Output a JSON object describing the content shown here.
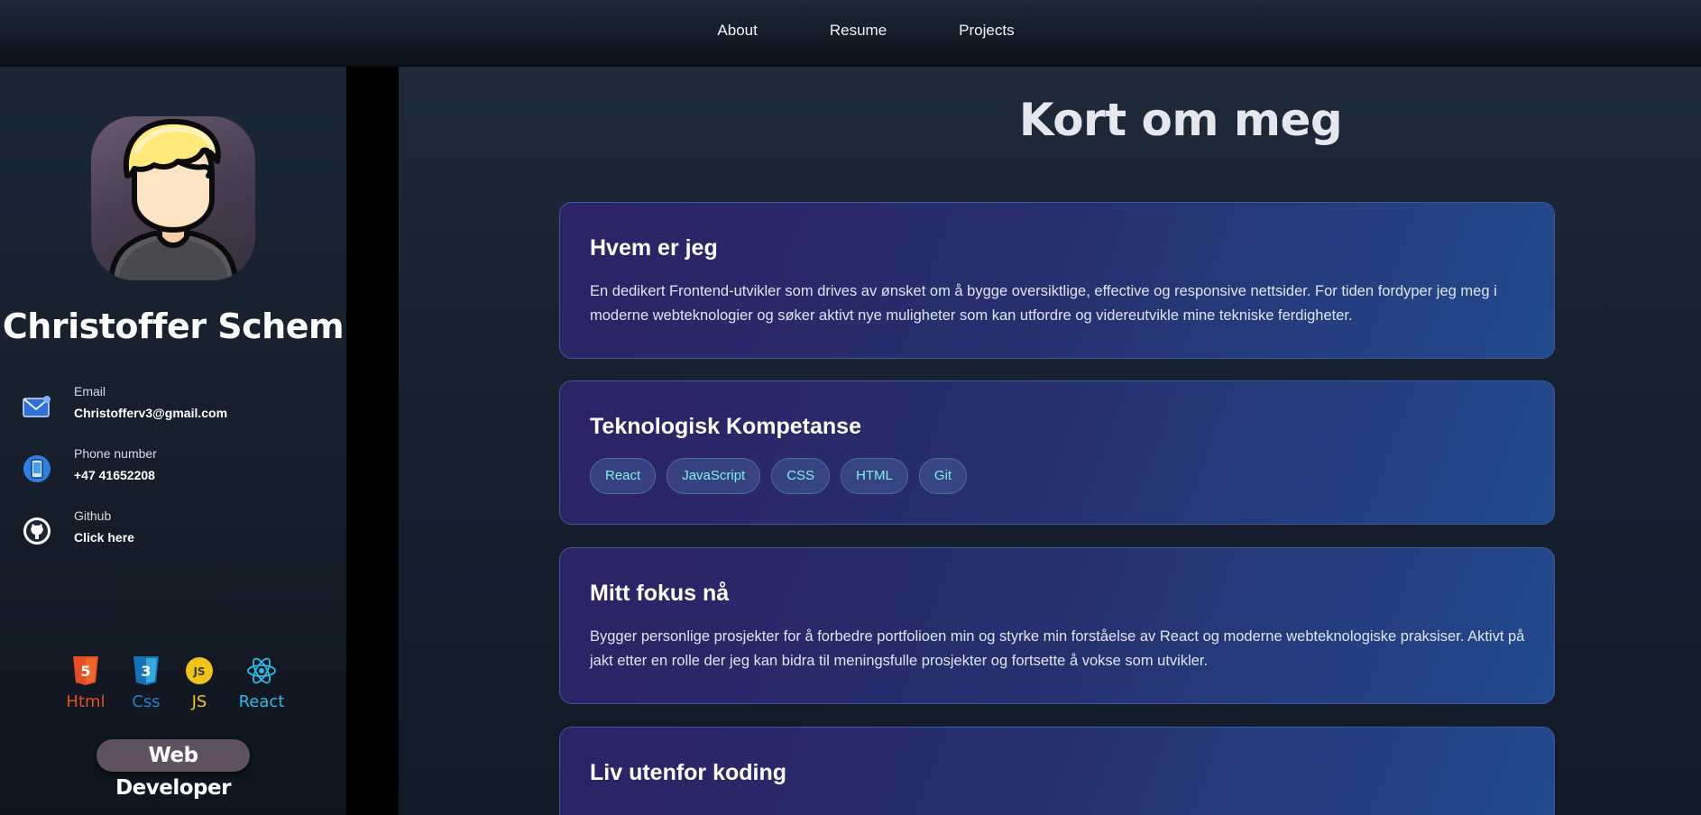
{
  "nav": {
    "items": [
      "About",
      "Resume",
      "Projects"
    ]
  },
  "profile": {
    "name": "Christoffer Schem",
    "contacts": [
      {
        "label": "Email",
        "value": "Christofferv3@gmail.com",
        "icon": "mail-icon"
      },
      {
        "label": "Phone number",
        "value": "+47 41652208",
        "icon": "phone-icon"
      },
      {
        "label": "Github",
        "value": "Click here",
        "icon": "github-icon"
      }
    ],
    "skills": [
      {
        "name": "Html",
        "color": "#e44d26",
        "icon": "html5-icon"
      },
      {
        "name": "Css",
        "color": "#2a7fc9",
        "icon": "css3-icon"
      },
      {
        "name": "JS",
        "color": "#f0c419",
        "icon": "js-icon"
      },
      {
        "name": "React",
        "color": "#2fb9e6",
        "icon": "react-icon"
      }
    ],
    "badge": "Web Developer"
  },
  "main": {
    "title": "Kort om meg",
    "cards": [
      {
        "heading": "Hvem er jeg",
        "text": "En dedikert Frontend-utvikler som drives av ønsket om å bygge oversiktlige, effective og responsive nettsider. For tiden fordyper jeg meg i moderne webteknologier og søker aktivt nye muligheter som kan utfordre og videreutvikle mine tekniske ferdigheter."
      },
      {
        "heading": "Teknologisk Kompetanse",
        "tags": [
          "React",
          "JavaScript",
          "CSS",
          "HTML",
          "Git"
        ]
      },
      {
        "heading": "Mitt fokus nå",
        "text": "Bygger personlige prosjekter for å forbedre portfolioen min og styrke min forståelse av React og moderne webteknologiske praksiser. Aktivt på jakt etter en rolle der jeg kan bidra til meningsfulle prosjekter og fortsette å vokse som utvikler."
      },
      {
        "heading": "Liv utenfor koding",
        "text": ""
      }
    ]
  },
  "colors": {
    "accent_tag_text": "#7ef0e8",
    "card_gradient_start": "#2c2266",
    "card_gradient_end": "#224a8e"
  }
}
